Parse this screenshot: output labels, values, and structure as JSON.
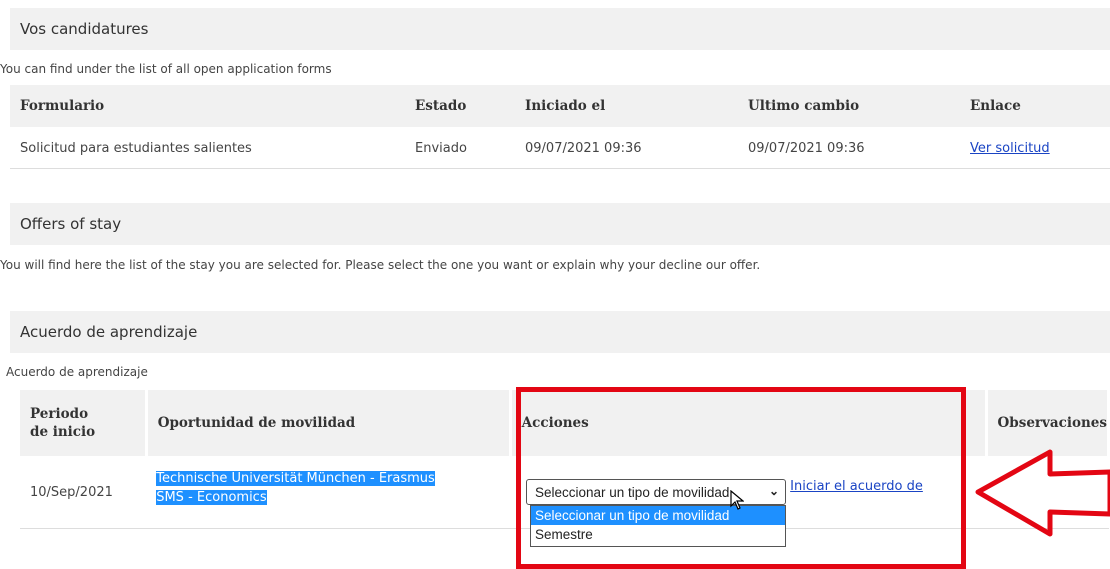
{
  "applications": {
    "title": "Vos candidatures",
    "subtitle": "You can find under the list of all open application forms",
    "columns": [
      "Formulario",
      "Estado",
      "Iniciado el",
      "Ultimo cambio",
      "Enlace"
    ],
    "rows": [
      {
        "form": "Solicitud para estudiantes salientes",
        "status": "Enviado",
        "started": "09/07/2021 09:36",
        "changed": "09/07/2021 09:36",
        "link": "Ver solicitud"
      }
    ]
  },
  "offers": {
    "title": "Offers of stay",
    "subtitle": "You will find here the list of the stay you are selected for. Please select the one you want or explain why your decline our offer."
  },
  "learning_agreement": {
    "title": "Acuerdo de aprendizaje",
    "subtitle": "Acuerdo de aprendizaje",
    "columns": [
      "Periodo de inicio",
      "Oportunidad de movilidad",
      "Acciones",
      "Observaciones"
    ],
    "row": {
      "start": "10/Sep/2021",
      "opportunity_line1": "Technische Universität München - Erasmus",
      "opportunity_line2": "SMS - Economics",
      "select_value": "Seleccionar un tipo de movilidad",
      "action_link": "Iniciar el acuerdo de"
    },
    "dropdown_options": [
      "Seleccionar un tipo de movilidad",
      "Semestre"
    ]
  },
  "colors": {
    "annotation_red": "#e30613",
    "selection_blue": "#1e90ff",
    "link_blue": "#1a44c4"
  }
}
